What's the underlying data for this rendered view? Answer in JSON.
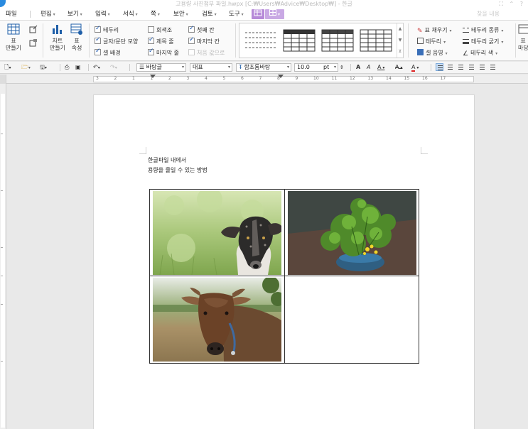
{
  "window": {
    "title": "고용량 사진첨부 파일.hwpx [C:₩Users₩Advice₩Desktop₩] - 한글",
    "controls": "⛶ ⌃ ?"
  },
  "menu": {
    "items": [
      "파일",
      "편집",
      "보기",
      "입력",
      "서식",
      "쪽",
      "보안",
      "검토",
      "도구"
    ],
    "search_placeholder": "찾을 내용"
  },
  "ribbon": {
    "make_table": "표\n만들기",
    "chart": "차트\n만들기",
    "table_props": "표\n속성",
    "checks": [
      {
        "label": "테두리",
        "checked": true
      },
      {
        "label": "회색조",
        "checked": false
      },
      {
        "label": "첫째 칸",
        "checked": true
      },
      {
        "label": "글자/문단 모양",
        "checked": true
      },
      {
        "label": "제목 줄",
        "checked": true
      },
      {
        "label": "마지막 칸",
        "checked": true
      },
      {
        "label": "셀 배경",
        "checked": true
      },
      {
        "label": "마지막 줄",
        "checked": true
      },
      {
        "label": "처음 값으로",
        "checked": false
      }
    ],
    "right_tools": {
      "fill": "표 채우기",
      "border_kind": "테두리 종류",
      "border": "테두리",
      "border_width": "테두리 굵기",
      "cell_shade": "셀 음영",
      "border_color": "테두리 색",
      "cut_label": "표\n마당"
    }
  },
  "toolbar": {
    "style": "바탕글",
    "lang": "대표",
    "font": "함초롬바탕",
    "size": "10.0",
    "unit": "pt"
  },
  "ruler": {
    "numbers": [
      "3",
      "2",
      "1",
      "1",
      "2",
      "3",
      "4",
      "5",
      "6",
      "7",
      "8",
      "9",
      "10",
      "11",
      "12",
      "13",
      "14",
      "15",
      "16",
      "17"
    ]
  },
  "document": {
    "line1": "한글파일 내에서",
    "line2": "용량을 줄일 수 있는 방법"
  },
  "photos": [
    {
      "subject": "dog",
      "cell": "top-left"
    },
    {
      "subject": "lettuce-plant",
      "cell": "top-right"
    },
    {
      "subject": "cow",
      "cell": "bottom-left"
    },
    {
      "subject": "empty",
      "cell": "bottom-right"
    }
  ],
  "colors": {
    "accent_tab": "#b68ad8",
    "check": "#1a56b0",
    "brand": "#2a8be0"
  }
}
